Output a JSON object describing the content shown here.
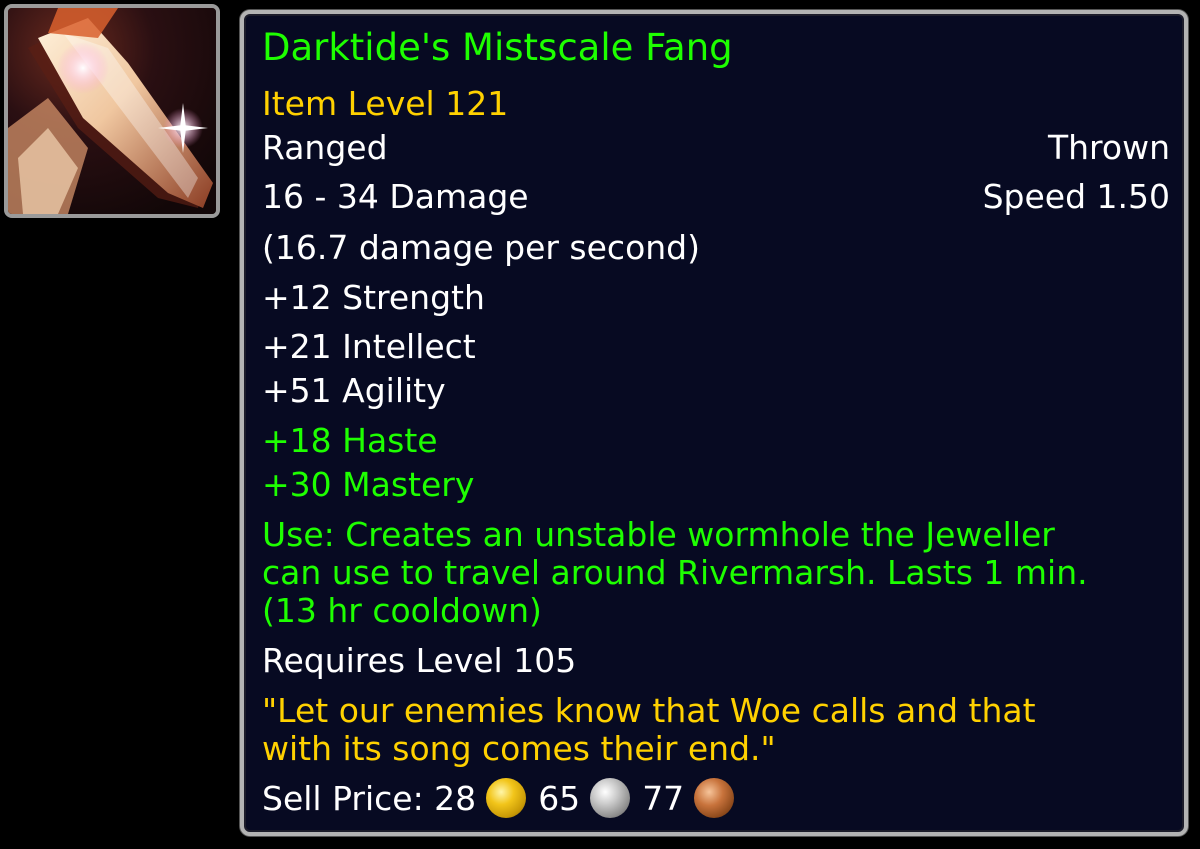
{
  "item": {
    "name": "Darktide's Mistscale Fang",
    "item_level": "Item Level 121",
    "slot": "Ranged",
    "weapon_type": "Thrown",
    "damage": "16 - 34 Damage",
    "speed": "Speed 1.50",
    "dps": "(16.7 damage per second)",
    "stats": [
      "+12 Strength",
      "+21 Intellect",
      "+51 Agility"
    ],
    "bonus_stats": [
      "+18 Haste",
      "+30 Mastery"
    ],
    "use_lines": [
      "Use: Creates an unstable wormhole the Jeweller",
      "can use to travel around Rivermarsh. Lasts 1 min.",
      "(13 hr cooldown)"
    ],
    "requires": "Requires Level 105",
    "flavor_lines": [
      "\"Let our enemies know that Woe calls and that",
      "with its song comes their end.\""
    ],
    "sell_price": {
      "label": "Sell Price: 28",
      "silver": "65",
      "copper": "77"
    },
    "icon": "dagger-icon"
  },
  "colors": {
    "name": "#1eff00",
    "item_level": "#ffd100",
    "bonus": "#1eff00",
    "flavor": "#ffd100",
    "background": "#070a22",
    "border": "#b3b3b3"
  }
}
